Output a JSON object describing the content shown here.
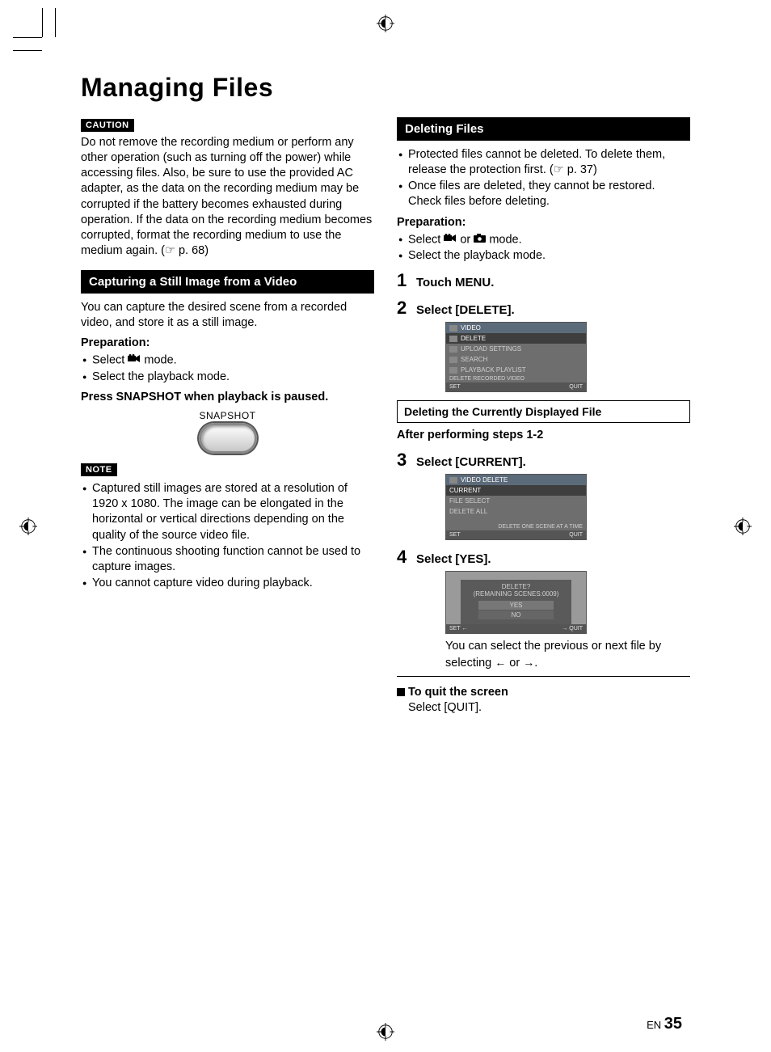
{
  "title": "Managing Files",
  "caution": {
    "label": "CAUTION",
    "text": "Do not remove the recording medium or perform any other operation (such as turning off the power) while accessing files. Also, be sure to use the provided AC adapter, as the data on the recording medium may be corrupted if the battery becomes exhausted during operation. If the data on the recording medium becomes corrupted, format the recording medium to use the medium again. (☞ p. 68)"
  },
  "left": {
    "section_title": "Capturing a Still Image from a Video",
    "intro": "You can capture the desired scene from a recorded video, and store it as a still image.",
    "prep_label": "Preparation:",
    "prep_items_a": "Select ",
    "prep_items_a2": " mode.",
    "prep_items_b": "Select the playback mode.",
    "instruction": "Press SNAPSHOT when playback is paused.",
    "snapshot_label": "SNAPSHOT",
    "note_label": "NOTE",
    "notes": [
      "Captured still images are stored at a resolution of 1920 x 1080. The image can be elongated in the horizontal or vertical directions depending on the quality of the source video file.",
      "The continuous shooting function cannot be used to capture images.",
      "You cannot capture video during playback."
    ]
  },
  "right": {
    "section_title": "Deleting Files",
    "bullets": [
      "Protected files cannot be deleted. To delete them, release the protection first. (☞ p. 37)",
      "Once files are deleted, they cannot be restored. Check files before deleting."
    ],
    "prep_label": "Preparation:",
    "prep_items_a1": "Select ",
    "prep_items_a2": " or ",
    "prep_items_a3": " mode.",
    "prep_items_b": "Select the playback mode.",
    "step1": "Touch MENU.",
    "step2": "Select [DELETE].",
    "screen2": {
      "rows": [
        "VIDEO",
        "DELETE",
        "UPLOAD SETTINGS",
        "SEARCH",
        "PLAYBACK PLAYLIST"
      ],
      "footer": "DELETE RECORDED VIDEO",
      "left": "SET",
      "right": "QUIT"
    },
    "sub_title": "Deleting the Currently Displayed File",
    "after": "After performing steps 1-2",
    "step3": "Select [CURRENT].",
    "screen3": {
      "hdr": "VIDEO DELETE",
      "rows": [
        "CURRENT",
        "FILE SELECT",
        "DELETE ALL"
      ],
      "footer": "DELETE ONE SCENE AT A TIME",
      "left": "SET",
      "right": "QUIT"
    },
    "step4": "Select [YES].",
    "screen4": {
      "msg1": "DELETE?",
      "msg2": "(REMAINING SCENES:0009)",
      "yes": "YES",
      "no": "NO",
      "left": "SET",
      "right": "QUIT"
    },
    "nav_note_a": "You can select the previous or next file by selecting ",
    "nav_note_b": " or ",
    "nav_note_c": ".",
    "quit_heading": "To quit the screen",
    "quit_body": "Select [QUIT]."
  },
  "footer": {
    "lang": "EN",
    "page": "35"
  }
}
